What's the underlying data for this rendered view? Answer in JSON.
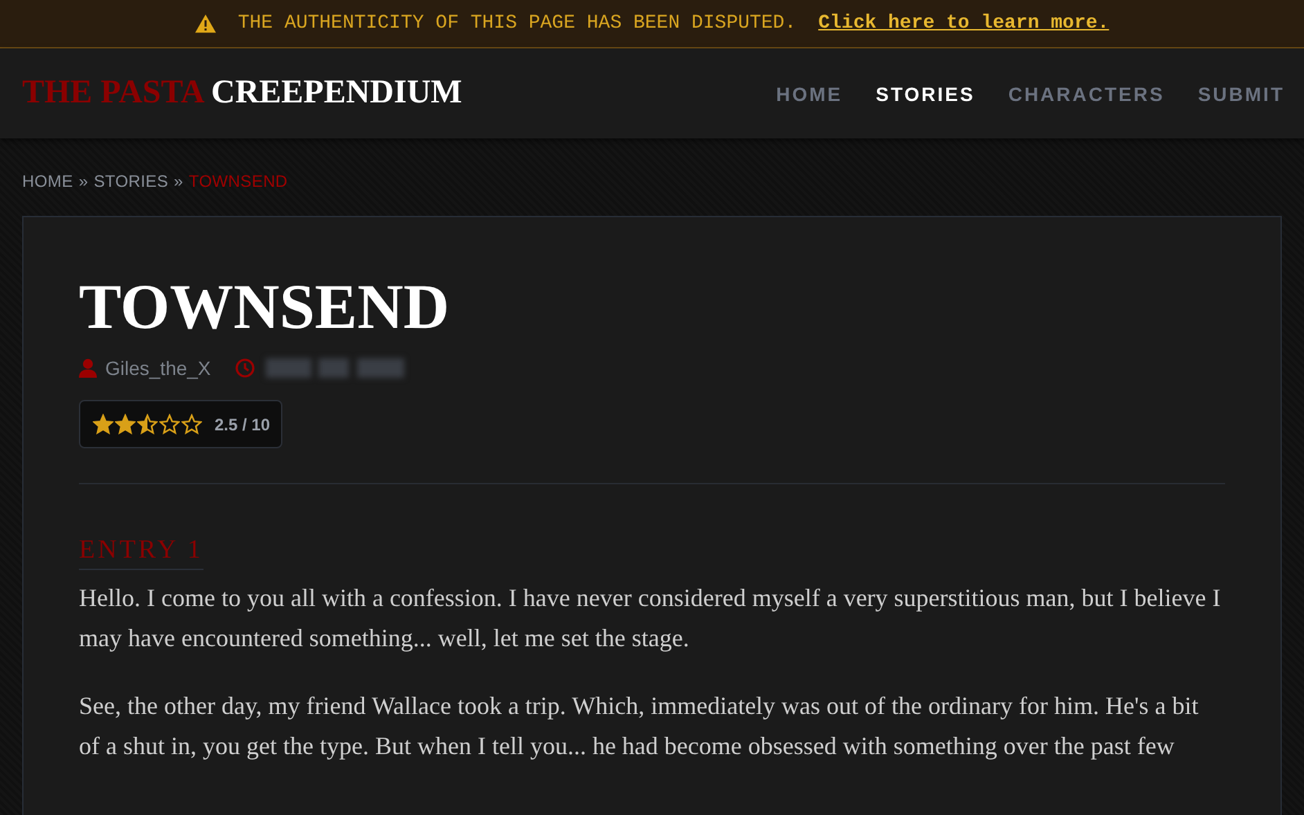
{
  "notice": {
    "text": "THE AUTHENTICITY OF THIS PAGE HAS BEEN DISPUTED.",
    "link": "Click here to learn more."
  },
  "header": {
    "logo_accent": "THE PASTA",
    "logo_main": "CREEPENDIUM",
    "nav": [
      {
        "label": "HOME",
        "selected": false
      },
      {
        "label": "STORIES",
        "selected": true
      },
      {
        "label": "CHARACTERS",
        "selected": false
      },
      {
        "label": "SUBMIT",
        "selected": false
      }
    ]
  },
  "breadcrumb": {
    "separator": "»",
    "items": [
      {
        "label": "HOME",
        "current": false
      },
      {
        "label": "STORIES",
        "current": false
      },
      {
        "label": "TOWNSEND",
        "current": true
      }
    ]
  },
  "story": {
    "title": "TOWNSEND",
    "author": "Giles_the_X",
    "date_hidden": true,
    "rating": {
      "stars": 2.5,
      "reading": "2.5 / 10"
    },
    "entries": [
      {
        "heading": "ENTRY 1",
        "paragraphs": [
          "Hello. I come to you all with a confession. I have never considered myself a very superstitious man, but I believe I may have encountered something... well, let me set the stage.",
          "See, the other day, my friend Wallace took a trip. Which, immediately was out of the ordinary for him. He's a bit of a shut in, you get the type. But when I tell you... he had become obsessed with something over the past few"
        ]
      }
    ]
  }
}
